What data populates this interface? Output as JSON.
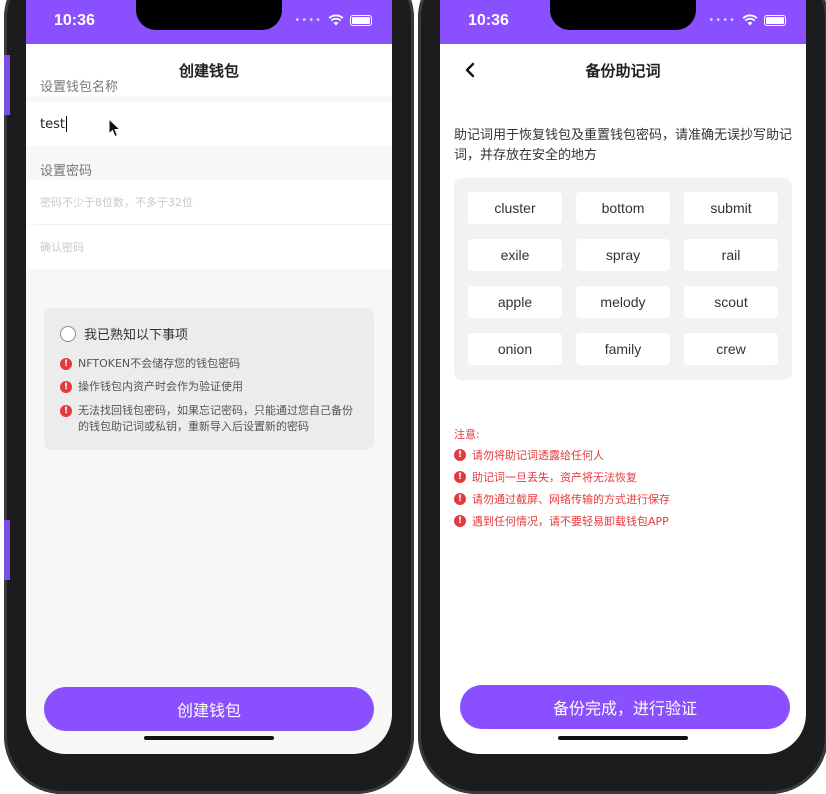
{
  "colors": {
    "accent": "#8a4fff",
    "warning": "#e5393d"
  },
  "left_screen": {
    "status_time": "10:36",
    "title": "创建钱包",
    "wallet_name_label": "设置钱包名称",
    "wallet_name_value": "test",
    "password_label": "设置密码",
    "password_placeholder": "密码不少于8位数，不多于32位",
    "confirm_placeholder": "确认密码",
    "agree_label": "我已熟知以下事项",
    "notices": [
      "NFTOKEN不会储存您的钱包密码",
      "操作钱包内资产时会作为验证使用",
      "无法找回钱包密码，如果忘记密码，只能通过您自己备份的钱包助记词或私钥，重新导入后设置新的密码"
    ],
    "button_label": "创建钱包"
  },
  "right_screen": {
    "status_time": "10:36",
    "title": "备份助记词",
    "intro": "助记词用于恢复钱包及重置钱包密码，请准确无误抄写助记词，并存放在安全的地方",
    "words": [
      "cluster",
      "bottom",
      "submit",
      "exile",
      "spray",
      "rail",
      "apple",
      "melody",
      "scout",
      "onion",
      "family",
      "crew"
    ],
    "note_title": "注意:",
    "notes": [
      "请勿将助记词透露给任何人",
      "助记词一旦丢失，资产将无法恢复",
      "请勿通过截屏、网络传输的方式进行保存",
      "遇到任何情况，请不要轻易卸载钱包APP"
    ],
    "button_label": "备份完成，进行验证"
  },
  "icons": {
    "back": "chevron-left-icon",
    "warning": "exclamation-circle-icon",
    "wifi": "wifi-icon",
    "battery": "battery-icon",
    "cursor": "mouse-pointer-icon"
  }
}
